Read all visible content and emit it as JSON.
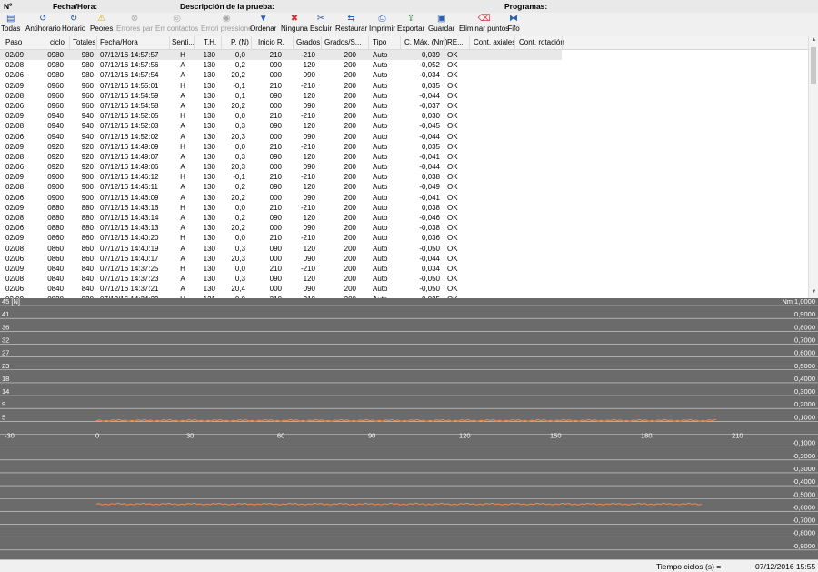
{
  "header": {
    "n": "Nº",
    "fecha_hora": "Fecha/Hora:",
    "descripcion": "Descripción de la prueba:",
    "programas": "Programas:"
  },
  "toolbar": [
    {
      "label": "Todas",
      "icon": "list-icon",
      "enabled": true
    },
    {
      "label": "Antihorario",
      "icon": "rotate-ccw-icon",
      "enabled": true
    },
    {
      "label": "Horario",
      "icon": "rotate-cw-icon",
      "enabled": true
    },
    {
      "label": "Peores",
      "icon": "warning-icon",
      "enabled": true
    },
    {
      "label": "Errores par",
      "icon": "error-circle-icon",
      "enabled": false
    },
    {
      "label": "Err contactos",
      "icon": "contacts-icon",
      "enabled": false
    },
    {
      "label": "Errori pressione",
      "icon": "pressure-icon",
      "enabled": false
    },
    {
      "label": "Ordenar",
      "icon": "funnel-icon",
      "enabled": true
    },
    {
      "label": "Ninguna",
      "icon": "clear-selection-icon",
      "enabled": true
    },
    {
      "label": "Escluir",
      "icon": "exclude-icon",
      "enabled": true
    },
    {
      "label": "Restaurar",
      "icon": "restore-icon",
      "enabled": true
    },
    {
      "label": "Imprimir",
      "icon": "printer-icon",
      "enabled": true
    },
    {
      "label": "Exportar",
      "icon": "export-icon",
      "enabled": true
    },
    {
      "label": "Guardar",
      "icon": "save-icon",
      "enabled": true
    },
    {
      "label": "Eliminar puntos",
      "icon": "eraser-icon",
      "enabled": true
    },
    {
      "label": "Fifo",
      "icon": "fifo-icon",
      "enabled": true
    }
  ],
  "table": {
    "columns": [
      "Paso",
      "ciclo",
      "Totales",
      "Fecha/Hora",
      "Senti...",
      "T.H.",
      "P. (N)",
      "Inicio R.",
      "Grados",
      "Grados/S...",
      "Tipo",
      "C. Máx. (Nm)",
      "RE...",
      "Cont. axiales",
      "Cont. rotación"
    ],
    "rows": [
      [
        "02/09",
        "0980",
        "980",
        "07/12/16 14:57:57",
        "H",
        "130",
        "0,0",
        "210",
        "-210",
        "200",
        "Auto",
        "0,039",
        "OK"
      ],
      [
        "02/08",
        "0980",
        "980",
        "07/12/16 14:57:56",
        "A",
        "130",
        "0,2",
        "090",
        "120",
        "200",
        "Auto",
        "-0,052",
        "OK"
      ],
      [
        "02/06",
        "0980",
        "980",
        "07/12/16 14:57:54",
        "A",
        "130",
        "20,2",
        "000",
        "090",
        "200",
        "Auto",
        "-0,034",
        "OK"
      ],
      [
        "02/09",
        "0960",
        "960",
        "07/12/16 14:55:01",
        "H",
        "130",
        "-0,1",
        "210",
        "-210",
        "200",
        "Auto",
        "0,035",
        "OK"
      ],
      [
        "02/08",
        "0960",
        "960",
        "07/12/16 14:54:59",
        "A",
        "130",
        "0,1",
        "090",
        "120",
        "200",
        "Auto",
        "-0,044",
        "OK"
      ],
      [
        "02/06",
        "0960",
        "960",
        "07/12/16 14:54:58",
        "A",
        "130",
        "20,2",
        "000",
        "090",
        "200",
        "Auto",
        "-0,037",
        "OK"
      ],
      [
        "02/09",
        "0940",
        "940",
        "07/12/16 14:52:05",
        "H",
        "130",
        "0,0",
        "210",
        "-210",
        "200",
        "Auto",
        "0,030",
        "OK"
      ],
      [
        "02/08",
        "0940",
        "940",
        "07/12/16 14:52:03",
        "A",
        "130",
        "0,3",
        "090",
        "120",
        "200",
        "Auto",
        "-0,045",
        "OK"
      ],
      [
        "02/06",
        "0940",
        "940",
        "07/12/16 14:52:02",
        "A",
        "130",
        "20,3",
        "000",
        "090",
        "200",
        "Auto",
        "-0,044",
        "OK"
      ],
      [
        "02/09",
        "0920",
        "920",
        "07/12/16 14:49:09",
        "H",
        "130",
        "0,0",
        "210",
        "-210",
        "200",
        "Auto",
        "0,035",
        "OK"
      ],
      [
        "02/08",
        "0920",
        "920",
        "07/12/16 14:49:07",
        "A",
        "130",
        "0,3",
        "090",
        "120",
        "200",
        "Auto",
        "-0,041",
        "OK"
      ],
      [
        "02/06",
        "0920",
        "920",
        "07/12/16 14:49:06",
        "A",
        "130",
        "20,3",
        "000",
        "090",
        "200",
        "Auto",
        "-0,044",
        "OK"
      ],
      [
        "02/09",
        "0900",
        "900",
        "07/12/16 14:46:12",
        "H",
        "130",
        "-0,1",
        "210",
        "-210",
        "200",
        "Auto",
        "0,038",
        "OK"
      ],
      [
        "02/08",
        "0900",
        "900",
        "07/12/16 14:46:11",
        "A",
        "130",
        "0,2",
        "090",
        "120",
        "200",
        "Auto",
        "-0,049",
        "OK"
      ],
      [
        "02/06",
        "0900",
        "900",
        "07/12/16 14:46:09",
        "A",
        "130",
        "20,2",
        "000",
        "090",
        "200",
        "Auto",
        "-0,041",
        "OK"
      ],
      [
        "02/09",
        "0880",
        "880",
        "07/12/16 14:43:16",
        "H",
        "130",
        "0,0",
        "210",
        "-210",
        "200",
        "Auto",
        "0,038",
        "OK"
      ],
      [
        "02/08",
        "0880",
        "880",
        "07/12/16 14:43:14",
        "A",
        "130",
        "0,2",
        "090",
        "120",
        "200",
        "Auto",
        "-0,046",
        "OK"
      ],
      [
        "02/06",
        "0880",
        "880",
        "07/12/16 14:43:13",
        "A",
        "130",
        "20,2",
        "000",
        "090",
        "200",
        "Auto",
        "-0,038",
        "OK"
      ],
      [
        "02/09",
        "0860",
        "860",
        "07/12/16 14:40:20",
        "H",
        "130",
        "0,0",
        "210",
        "-210",
        "200",
        "Auto",
        "0,036",
        "OK"
      ],
      [
        "02/08",
        "0860",
        "860",
        "07/12/16 14:40:19",
        "A",
        "130",
        "0,3",
        "090",
        "120",
        "200",
        "Auto",
        "-0,050",
        "OK"
      ],
      [
        "02/06",
        "0860",
        "860",
        "07/12/16 14:40:17",
        "A",
        "130",
        "20,3",
        "000",
        "090",
        "200",
        "Auto",
        "-0,044",
        "OK"
      ],
      [
        "02/09",
        "0840",
        "840",
        "07/12/16 14:37:25",
        "H",
        "130",
        "0,0",
        "210",
        "-210",
        "200",
        "Auto",
        "0,034",
        "OK"
      ],
      [
        "02/08",
        "0840",
        "840",
        "07/12/16 14:37:23",
        "A",
        "130",
        "0,3",
        "090",
        "120",
        "200",
        "Auto",
        "-0,050",
        "OK"
      ],
      [
        "02/06",
        "0840",
        "840",
        "07/12/16 14:37:21",
        "A",
        "130",
        "20,4",
        "000",
        "090",
        "200",
        "Auto",
        "-0,050",
        "OK"
      ],
      [
        "02/09",
        "0820",
        "820",
        "07/12/16 14:34:29",
        "H",
        "131",
        "0,0",
        "210",
        "-210",
        "200",
        "Auto",
        "0,035",
        "OK"
      ]
    ]
  },
  "chart_data": {
    "type": "line",
    "background": "#6b6b6b",
    "line_color": "#e8884a",
    "grid_color": "#d8d8d8",
    "left_axis": {
      "unit": "[N]",
      "ticks": [
        "45",
        "41",
        "36",
        "32",
        "27",
        "23",
        "18",
        "14",
        "9",
        "5"
      ]
    },
    "right_axis": {
      "unit": "Nm",
      "ticks": [
        "1,0000",
        "0,9000",
        "0,8000",
        "0,7000",
        "0,6000",
        "0,5000",
        "0,4000",
        "0,3000",
        "0,2000",
        "0,1000",
        "-0,1000",
        "-0,2000",
        "-0,3000",
        "-0,4000",
        "-0,5000",
        "-0,6000",
        "-0,7000",
        "-0,8000",
        "-0,9000"
      ]
    },
    "x_axis": {
      "ticks": [
        "-30",
        "0",
        "30",
        "60",
        "90",
        "120",
        "150",
        "180",
        "210"
      ],
      "xlim": [
        -30,
        210
      ]
    },
    "series": [
      {
        "xlim": [
          0,
          205
        ],
        "y_right": 0.1,
        "note_ripple": true
      },
      {
        "xlim": [
          0,
          200
        ],
        "y_right": -0.55,
        "note_ripple": true
      }
    ]
  },
  "status": {
    "label": "Tiempo ciclos (s) =",
    "datetime": "07/12/2016 15:55"
  }
}
